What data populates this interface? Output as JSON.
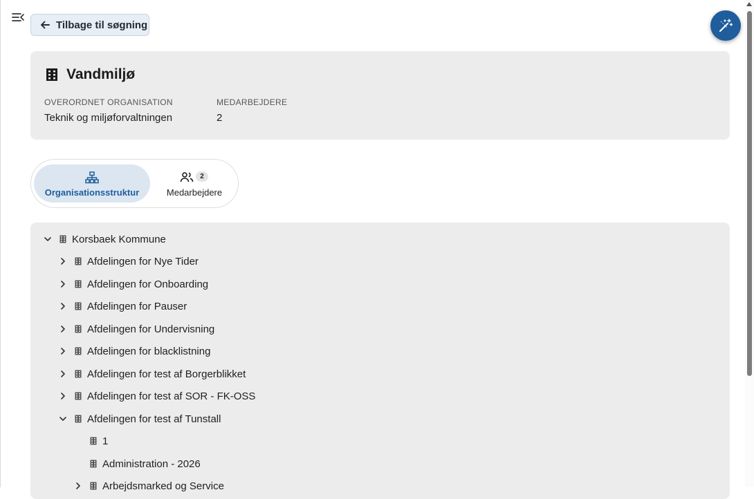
{
  "header": {
    "back_label": "Tilbage til søgning",
    "menu_icon": "menu-collapse-icon",
    "magic_icon": "magic-wand-icon"
  },
  "org": {
    "name": "Vandmiljø",
    "icon": "building-icon",
    "parent_label": "OVERORDNET ORGANISATION",
    "parent_value": "Teknik og miljøforvaltningen",
    "staff_label": "MEDARBEJDERE",
    "staff_value": "2"
  },
  "tabs": {
    "structure_label": "Organisationsstruktur",
    "staff_label": "Medarbejdere",
    "staff_count": "2",
    "active": "structure"
  },
  "tree": {
    "items": [
      {
        "label": "Korsbaek Kommune",
        "level": 0,
        "state": "expanded"
      },
      {
        "label": "Afdelingen for Nye Tider",
        "level": 1,
        "state": "collapsed"
      },
      {
        "label": "Afdelingen for Onboarding",
        "level": 1,
        "state": "collapsed"
      },
      {
        "label": "Afdelingen for Pauser",
        "level": 1,
        "state": "collapsed"
      },
      {
        "label": "Afdelingen for Undervisning",
        "level": 1,
        "state": "collapsed"
      },
      {
        "label": "Afdelingen for blacklistning",
        "level": 1,
        "state": "collapsed"
      },
      {
        "label": "Afdelingen for test af Borgerblikket",
        "level": 1,
        "state": "collapsed"
      },
      {
        "label": "Afdelingen for test af SOR - FK-OSS",
        "level": 1,
        "state": "collapsed"
      },
      {
        "label": "Afdelingen for test af Tunstall",
        "level": 1,
        "state": "expanded"
      },
      {
        "label": "1",
        "level": 2,
        "state": "leaf"
      },
      {
        "label": "Administration - 2026",
        "level": 2,
        "state": "leaf"
      },
      {
        "label": "Arbejdsmarked og Service",
        "level": 2,
        "state": "collapsed"
      }
    ]
  },
  "colors": {
    "accent": "#1f5d9c",
    "card_bg": "#ececec",
    "tab_active_bg": "#dbe6f1"
  }
}
